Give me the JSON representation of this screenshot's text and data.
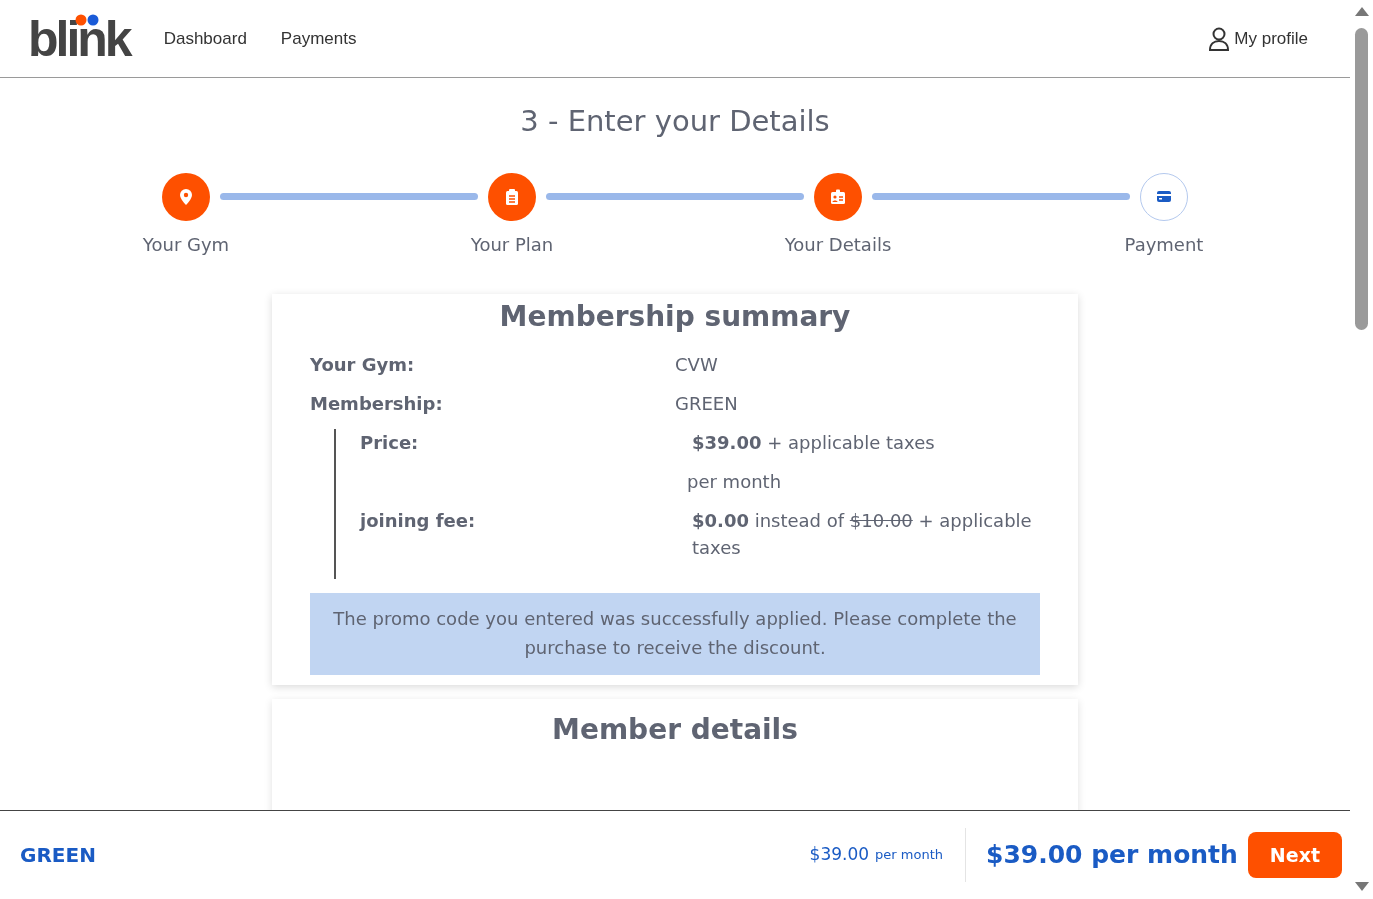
{
  "header": {
    "logo": "blink",
    "nav": [
      {
        "label": "Dashboard"
      },
      {
        "label": "Payments"
      }
    ],
    "profile": "My profile"
  },
  "title": "3 - Enter your Details",
  "steps": [
    {
      "label": "Your Gym",
      "kind": "pin",
      "completed": true
    },
    {
      "label": "Your Plan",
      "kind": "clipboard",
      "completed": true
    },
    {
      "label": "Your Details",
      "kind": "id",
      "completed": true
    },
    {
      "label": "Payment",
      "kind": "card",
      "completed": false
    }
  ],
  "summary": {
    "title": "Membership summary",
    "rows": [
      {
        "label": "Your Gym:",
        "value": "CVW"
      },
      {
        "label": "Membership:",
        "value": "GREEN"
      }
    ],
    "details": [
      {
        "label": "Price:",
        "parts": [
          {
            "text": "$39.00",
            "kind": "amount"
          },
          {
            "text": " + applicable taxes",
            "kind": "text"
          }
        ],
        "note": "per month"
      },
      {
        "label": "joining fee:",
        "parts": [
          {
            "text": "$0.00",
            "kind": "amount"
          },
          {
            "text": " instead of ",
            "kind": "text"
          },
          {
            "text": "$10.00",
            "kind": "former"
          },
          {
            "text": " + applicable taxes",
            "kind": "text"
          }
        ]
      }
    ],
    "notice": "The promo code you entered was successfully applied. Please complete the purchase to receive the discount."
  },
  "member_details": {
    "title": "Member details"
  },
  "footer": {
    "plan": "GREEN",
    "price_small": {
      "amount": "$39.00",
      "period": "per month"
    },
    "price_large": "$39.00 per month",
    "next": "Next"
  }
}
